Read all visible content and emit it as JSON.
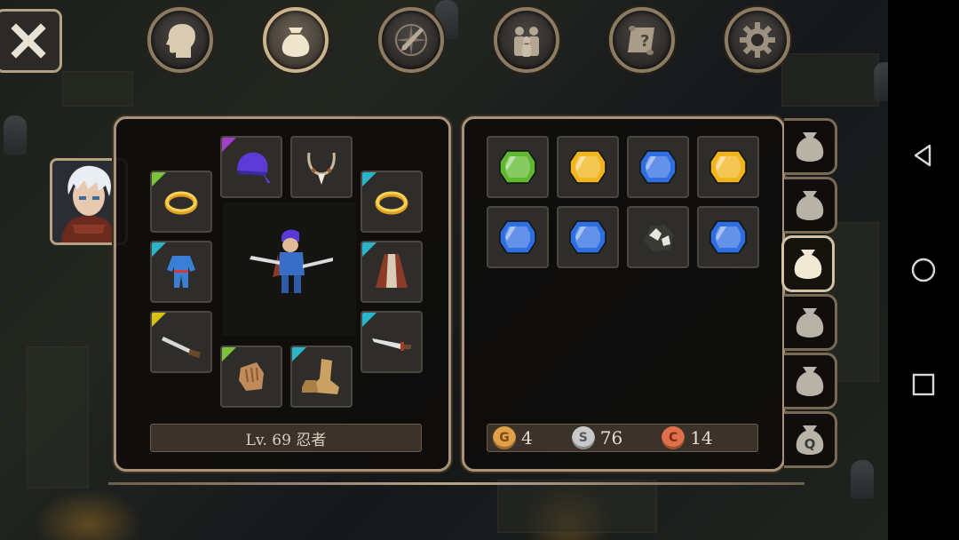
{
  "top_menu": {
    "items": [
      {
        "name": "character",
        "icon": "head-icon",
        "active": false
      },
      {
        "name": "inventory",
        "icon": "bag-icon",
        "active": true
      },
      {
        "name": "skills",
        "icon": "sword-compass-icon",
        "active": false
      },
      {
        "name": "party",
        "icon": "people-icon",
        "active": false
      },
      {
        "name": "quests",
        "icon": "scroll-question-icon",
        "active": false
      },
      {
        "name": "settings",
        "icon": "gear-icon",
        "active": false
      }
    ]
  },
  "equipment": {
    "level_label": "Lv. 69 忍者",
    "slots": [
      {
        "slot": "ring-left",
        "item": "gold-ring-icon",
        "rarity_color": "#7cc23a"
      },
      {
        "slot": "head",
        "item": "purple-bandana-icon",
        "rarity_color": "#a040c8"
      },
      {
        "slot": "necklace",
        "item": "fang-necklace-icon",
        "rarity_color": ""
      },
      {
        "slot": "ring-right",
        "item": "gold-ring-icon",
        "rarity_color": "#2bb5c8"
      },
      {
        "slot": "body",
        "item": "blue-ninja-suit-icon",
        "rarity_color": "#2bb5c8"
      },
      {
        "slot": "cloak",
        "item": "red-cloak-icon",
        "rarity_color": "#2bb5c8"
      },
      {
        "slot": "main-hand",
        "item": "shuriken-blade-icon",
        "rarity_color": "#d8c21a"
      },
      {
        "slot": "off-hand",
        "item": "dagger-icon",
        "rarity_color": "#2bb5c8"
      },
      {
        "slot": "gloves",
        "item": "leather-glove-icon",
        "rarity_color": "#7cc23a"
      },
      {
        "slot": "boots",
        "item": "leather-boots-icon",
        "rarity_color": "#2bb5c8"
      }
    ]
  },
  "bag": {
    "items": [
      {
        "item": "green-gem-icon",
        "color": "#5fb82e"
      },
      {
        "item": "yellow-gem-icon",
        "color": "#f0b41c"
      },
      {
        "item": "blue-gem-icon",
        "color": "#2f6ee0"
      },
      {
        "item": "yellow-gem-icon",
        "color": "#f0b41c"
      },
      {
        "item": "blue-gem-icon",
        "color": "#2f6ee0"
      },
      {
        "item": "blue-gem-icon",
        "color": "#2f6ee0"
      },
      {
        "item": "white-ore-icon",
        "color": "#e6e6e0"
      },
      {
        "item": "blue-gem-icon",
        "color": "#2f6ee0"
      }
    ],
    "currency": {
      "gold": {
        "symbol": "G",
        "value": "4",
        "color": "#e2a04a"
      },
      "silver": {
        "symbol": "S",
        "value": "76",
        "color": "#c9c9c9"
      },
      "copper": {
        "symbol": "C",
        "value": "14",
        "color": "#e0704a"
      }
    },
    "tabs": [
      {
        "label": "",
        "active": false
      },
      {
        "label": "",
        "active": false
      },
      {
        "label": "",
        "active": true
      },
      {
        "label": "",
        "active": false
      },
      {
        "label": "",
        "active": false
      },
      {
        "label": "Q",
        "active": false
      }
    ]
  },
  "android_nav": [
    "back-icon",
    "home-icon",
    "recents-icon"
  ]
}
